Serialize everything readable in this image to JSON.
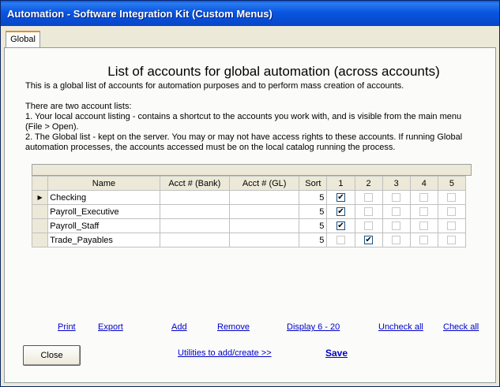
{
  "window": {
    "title": "Automation - Software Integration Kit (Custom Menus)"
  },
  "tabs": [
    {
      "label": "Global"
    }
  ],
  "main": {
    "heading": "List of accounts for global automation (across accounts)",
    "desc1": "This is a global list of accounts for automation purposes and to perform mass creation of accounts.",
    "desc2": "There are two account lists:",
    "desc3": "1. Your local account listing - contains a shortcut to the accounts you work with, and is visible from the main menu (File > Open).",
    "desc4": "2. The Global list - kept on the server.  You may or may not have access rights to these accounts.  If running Global automation processes, the accounts accessed must be on the local catalog running the process."
  },
  "grid": {
    "columns": [
      "Name",
      "Acct # (Bank)",
      "Acct # (GL)",
      "Sort",
      "1",
      "2",
      "3",
      "4",
      "5"
    ],
    "current_row_marker": "▶",
    "rows": [
      {
        "name": "Checking",
        "bank": "",
        "gl": "",
        "sort": "5",
        "checks": [
          true,
          false,
          false,
          false,
          false
        ]
      },
      {
        "name": "Payroll_Executive",
        "bank": "",
        "gl": "",
        "sort": "5",
        "checks": [
          true,
          false,
          false,
          false,
          false
        ]
      },
      {
        "name": "Payroll_Staff",
        "bank": "",
        "gl": "",
        "sort": "5",
        "checks": [
          true,
          false,
          false,
          false,
          false
        ]
      },
      {
        "name": "Trade_Payables",
        "bank": "",
        "gl": "",
        "sort": "5",
        "checks": [
          false,
          true,
          false,
          false,
          false
        ]
      }
    ]
  },
  "links": {
    "print": "Print",
    "export": "Export",
    "add": "Add",
    "remove": "Remove",
    "display": "Display 6 - 20",
    "uncheck_all": "Uncheck all",
    "check_all": "Check all",
    "utilities": "Utilities to add/create >>",
    "save": "Save"
  },
  "buttons": {
    "close": "Close"
  },
  "icons": {
    "checkmark": "✔"
  }
}
